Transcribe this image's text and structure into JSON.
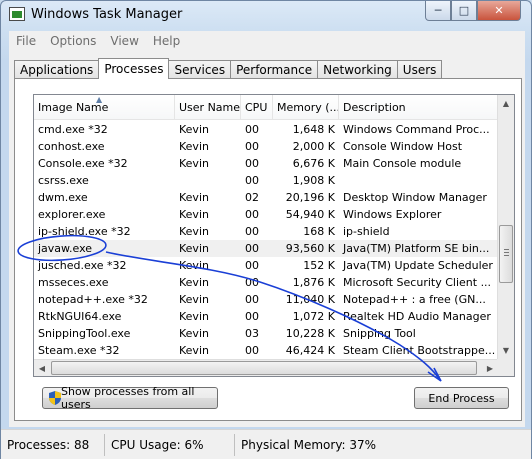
{
  "window": {
    "title": "Windows Task Manager"
  },
  "menu": [
    "File",
    "Options",
    "View",
    "Help"
  ],
  "tabs": [
    "Applications",
    "Processes",
    "Services",
    "Performance",
    "Networking",
    "Users"
  ],
  "active_tab": "Processes",
  "columns": [
    "Image Name",
    "User Name",
    "CPU",
    "Memory (...",
    "Description"
  ],
  "processes": [
    {
      "name": "cmd.exe *32",
      "user": "Kevin",
      "cpu": "00",
      "mem": "1,648 K",
      "desc": "Windows Command Proc..."
    },
    {
      "name": "conhost.exe",
      "user": "Kevin",
      "cpu": "00",
      "mem": "2,000 K",
      "desc": "Console Window Host"
    },
    {
      "name": "Console.exe *32",
      "user": "Kevin",
      "cpu": "00",
      "mem": "6,676 K",
      "desc": "Main Console module"
    },
    {
      "name": "csrss.exe",
      "user": "",
      "cpu": "00",
      "mem": "1,908 K",
      "desc": ""
    },
    {
      "name": "dwm.exe",
      "user": "Kevin",
      "cpu": "02",
      "mem": "20,196 K",
      "desc": "Desktop Window Manager"
    },
    {
      "name": "explorer.exe",
      "user": "Kevin",
      "cpu": "00",
      "mem": "54,940 K",
      "desc": "Windows Explorer"
    },
    {
      "name": "ip-shield.exe *32",
      "user": "Kevin",
      "cpu": "00",
      "mem": "168 K",
      "desc": "ip-shield"
    },
    {
      "name": "javaw.exe",
      "user": "Kevin",
      "cpu": "00",
      "mem": "93,560 K",
      "desc": "Java(TM) Platform SE bin..."
    },
    {
      "name": "jusched.exe *32",
      "user": "Kevin",
      "cpu": "00",
      "mem": "152 K",
      "desc": "Java(TM) Update Scheduler"
    },
    {
      "name": "msseces.exe",
      "user": "Kevin",
      "cpu": "00",
      "mem": "1,876 K",
      "desc": "Microsoft Security Client ..."
    },
    {
      "name": "notepad++.exe *32",
      "user": "Kevin",
      "cpu": "00",
      "mem": "11,040 K",
      "desc": "Notepad++ : a free (GN..."
    },
    {
      "name": "RtkNGUI64.exe",
      "user": "Kevin",
      "cpu": "00",
      "mem": "1,072 K",
      "desc": "Realtek HD Audio Manager"
    },
    {
      "name": "SnippingTool.exe",
      "user": "Kevin",
      "cpu": "03",
      "mem": "10,228 K",
      "desc": "Snipping Tool"
    },
    {
      "name": "Steam.exe *32",
      "user": "Kevin",
      "cpu": "00",
      "mem": "46,424 K",
      "desc": "Steam Client Bootstrappe..."
    }
  ],
  "selected_process": "javaw.exe",
  "buttons": {
    "show_all": "Show processes from all users",
    "end_process": "End Process"
  },
  "status": {
    "processes": "Processes: 88",
    "cpu": "CPU Usage: 6%",
    "memory": "Physical Memory: 37%"
  },
  "colors": {
    "annotation_ink": "#1a3fd6",
    "titlebar": "#cddff1"
  }
}
